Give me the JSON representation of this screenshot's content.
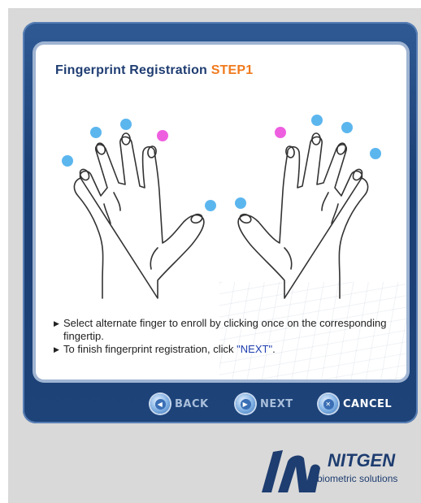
{
  "panel": {
    "title": "Fingerprint Registration",
    "step": "STEP1"
  },
  "instructions": [
    {
      "text": "Select alternate finger to enroll by clicking once on the corresponding fingertip."
    },
    {
      "before": "To finish fingerprint registration, click ",
      "highlight": "\"NEXT\"",
      "after": "."
    }
  ],
  "buttons": {
    "back": "BACK",
    "next": "NEXT",
    "cancel": "CANCEL"
  },
  "logo": {
    "name": "NITGEN",
    "tagline": "biometric solutions"
  },
  "colors": {
    "unselected_finger": "#5cb6ee",
    "selected_finger": "#ee5fe0",
    "frame": "#1d4379",
    "title": "#1f3d72",
    "step": "#f07a1e"
  },
  "fingers": [
    {
      "hand": "left",
      "finger": "pinky",
      "state": "unselected"
    },
    {
      "hand": "left",
      "finger": "ring",
      "state": "unselected"
    },
    {
      "hand": "left",
      "finger": "middle",
      "state": "unselected"
    },
    {
      "hand": "left",
      "finger": "index",
      "state": "selected"
    },
    {
      "hand": "left",
      "finger": "thumb",
      "state": "unselected"
    },
    {
      "hand": "right",
      "finger": "thumb",
      "state": "unselected"
    },
    {
      "hand": "right",
      "finger": "index",
      "state": "selected"
    },
    {
      "hand": "right",
      "finger": "middle",
      "state": "unselected"
    },
    {
      "hand": "right",
      "finger": "ring",
      "state": "unselected"
    },
    {
      "hand": "right",
      "finger": "pinky",
      "state": "unselected"
    }
  ]
}
